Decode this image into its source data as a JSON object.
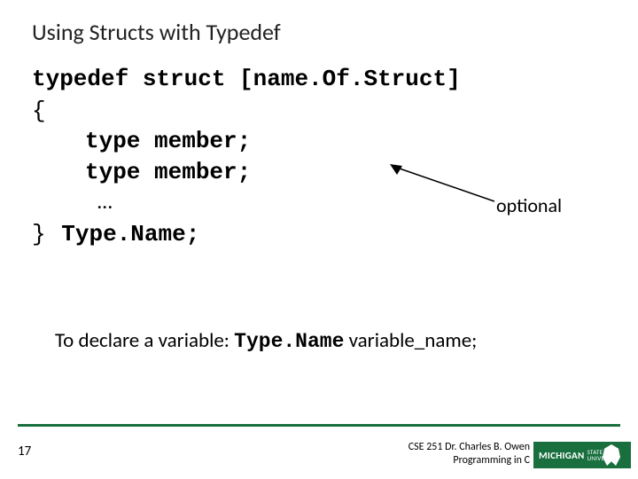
{
  "title": "Using Structs with Typedef",
  "code": {
    "decl": "typedef struct [name.Of.Struct]",
    "brace_open": "{",
    "member1": "type member;",
    "member2": "type member;",
    "ellipsis": "…",
    "brace_close": "}",
    "typename": "Type.Name",
    "semicolon": ";"
  },
  "annotation": {
    "label": "optional"
  },
  "declare": {
    "prefix": "To declare a variable:  ",
    "typename": "Type.Name",
    "suffix": " variable_name;"
  },
  "footer": {
    "page": "17",
    "credit_line1": "CSE 251 Dr. Charles B. Owen",
    "credit_line2": "Programming in C",
    "logo_main": "MICHIGAN",
    "logo_sub1": "STATE",
    "logo_sub2": "UNIVERSITY"
  }
}
